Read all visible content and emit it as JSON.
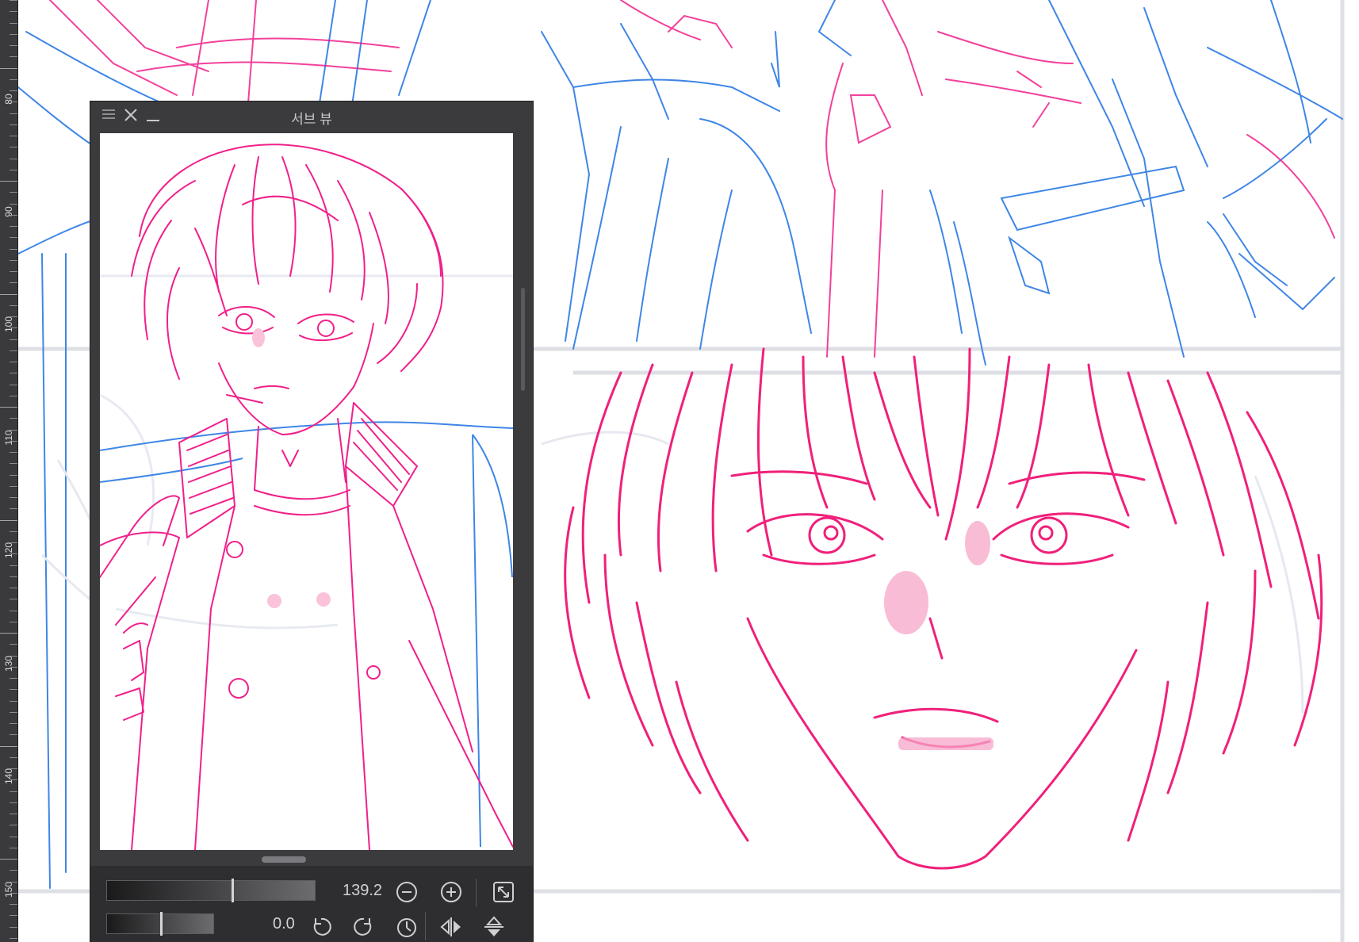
{
  "ruler": {
    "labels": [
      "80",
      "90",
      "100",
      "110",
      "120",
      "130",
      "140",
      "150"
    ]
  },
  "subview": {
    "title": "서브 뷰",
    "menu_icon": "hamburger-menu-icon",
    "close_icon": "close-icon",
    "minimize_icon": "minimize-icon",
    "zoom_value": "139.2",
    "zoom_slider_level": 0.6,
    "rotation_value": "0.0",
    "rotation_slider_level": 0.5
  },
  "icons": {
    "zoom_out": "zoom-out-icon",
    "zoom_in": "zoom-in-icon",
    "fit": "fit-to-view-icon",
    "rotate_left": "rotate-left-icon",
    "rotate_right": "rotate-right-icon",
    "reset_rotation": "reset-rotation-icon",
    "flip_h": "flip-horizontal-icon",
    "flip_v": "flip-vertical-icon"
  },
  "colors": {
    "pink_line": "#f0208a",
    "blue_line": "#3f86e6",
    "panel_bg": "#3b3b3d"
  }
}
